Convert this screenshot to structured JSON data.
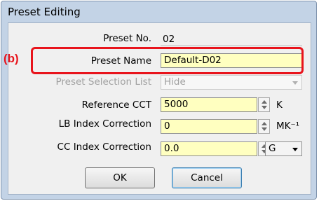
{
  "window": {
    "title": "Preset Editing"
  },
  "annotation": {
    "label": "(b)"
  },
  "form": {
    "preset_no": {
      "label": "Preset No.",
      "value": "02"
    },
    "preset_name": {
      "label": "Preset Name",
      "value": "Default-D02"
    },
    "preset_selection_list": {
      "label": "Preset Selection List",
      "value": "Hide"
    },
    "reference_cct": {
      "label": "Reference CCT",
      "value": "5000",
      "unit": "K"
    },
    "lb_index_correction": {
      "label": "LB Index Correction",
      "value": "0",
      "unit": "MK⁻¹"
    },
    "cc_index_correction": {
      "label": "CC Index Correction",
      "value": "0.0",
      "unit": "G"
    }
  },
  "buttons": {
    "ok": "OK",
    "cancel": "Cancel"
  },
  "colors": {
    "highlight": "#e8141c",
    "field_bg": "#ffffc0",
    "titlebar": "#c3d3e6"
  }
}
